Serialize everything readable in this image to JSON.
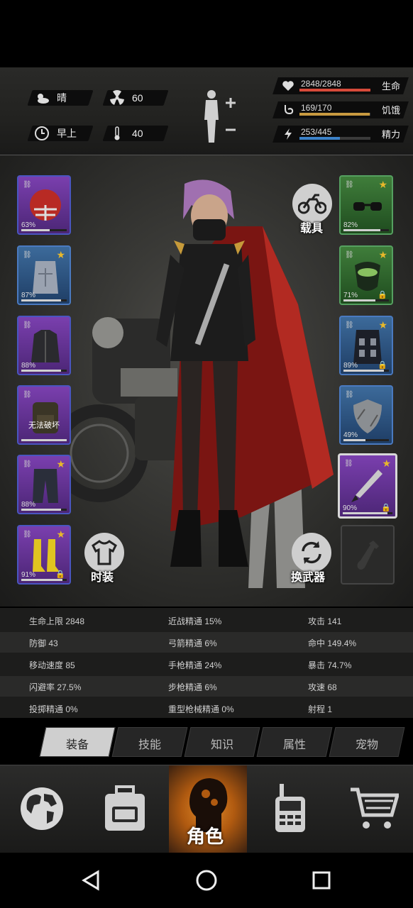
{
  "status": {
    "weather": "晴",
    "radiation": "60",
    "time_of_day": "早上",
    "temperature": "40"
  },
  "vitals": [
    {
      "label": "生命",
      "value": "2848/2848",
      "level": 1.0,
      "color": "#d64a3a",
      "icon": "heart-pulse-icon"
    },
    {
      "label": "饥饿",
      "value": "169/170",
      "level": 0.99,
      "color": "#c89a40",
      "icon": "stomach-icon"
    },
    {
      "label": "精力",
      "value": "253/445",
      "level": 0.57,
      "color": "#3c82c8",
      "icon": "energy-icon"
    }
  ],
  "left_slots": [
    {
      "name": "helmet-slot",
      "rarity": "purple",
      "pct": "63%",
      "durability": 0.63,
      "star": false,
      "lock": false,
      "icon": "football-helmet-icon"
    },
    {
      "name": "body-slot",
      "rarity": "blue",
      "pct": "87%",
      "durability": 0.87,
      "star": true,
      "lock": false,
      "icon": "torso-icon"
    },
    {
      "name": "jacket-slot",
      "rarity": "purple",
      "pct": "88%",
      "durability": 0.88,
      "star": false,
      "lock": false,
      "icon": "jacket-icon"
    },
    {
      "name": "backpack-slot",
      "rarity": "purple",
      "pct": "",
      "durability": 1.0,
      "star": false,
      "lock": false,
      "icon": "backpack-icon",
      "note": "无法破坏"
    },
    {
      "name": "pants-slot",
      "rarity": "purple",
      "pct": "88%",
      "durability": 0.88,
      "star": true,
      "lock": false,
      "icon": "pants-icon"
    },
    {
      "name": "boots-slot",
      "rarity": "purple",
      "pct": "91%",
      "durability": 0.91,
      "star": true,
      "lock": true,
      "icon": "boots-icon"
    }
  ],
  "right_slots": [
    {
      "name": "glasses-slot",
      "rarity": "green",
      "pct": "82%",
      "durability": 0.82,
      "star": true,
      "lock": false,
      "icon": "sunglasses-icon"
    },
    {
      "name": "mask-slot",
      "rarity": "green",
      "pct": "71%",
      "durability": 0.71,
      "star": true,
      "lock": true,
      "icon": "gas-mask-icon"
    },
    {
      "name": "vest-slot",
      "rarity": "blue",
      "pct": "89%",
      "durability": 0.89,
      "star": true,
      "lock": true,
      "icon": "tactical-vest-icon"
    },
    {
      "name": "shield-slot",
      "rarity": "blue",
      "pct": "49%",
      "durability": 0.49,
      "star": false,
      "lock": false,
      "icon": "shield-icon"
    },
    {
      "name": "weapon-slot",
      "rarity": "purple",
      "pct": "90%",
      "durability": 0.9,
      "star": true,
      "lock": true,
      "icon": "machete-icon"
    }
  ],
  "buttons": {
    "vehicle": "载具",
    "outfit": "时装",
    "swap_weapon": "换武器"
  },
  "stats": [
    [
      "生命上限 2848",
      "近战精通 15%",
      "攻击 141"
    ],
    [
      "防御 43",
      "弓箭精通 6%",
      "命中 149.4%"
    ],
    [
      "移动速度 85",
      "手枪精通 24%",
      "暴击 74.7%"
    ],
    [
      "闪避率 27.5%",
      "步枪精通 6%",
      "攻速 68"
    ],
    [
      "投掷精通 0%",
      "重型枪械精通 0%",
      "射程 1"
    ]
  ],
  "tabs": [
    "装备",
    "技能",
    "知识",
    "属性",
    "宠物"
  ],
  "active_tab": 0,
  "nav": {
    "items": [
      "world-map-icon",
      "backpack-icon",
      "character-icon",
      "walkie-talkie-icon",
      "shopping-cart-icon"
    ],
    "active_label": "角色"
  }
}
